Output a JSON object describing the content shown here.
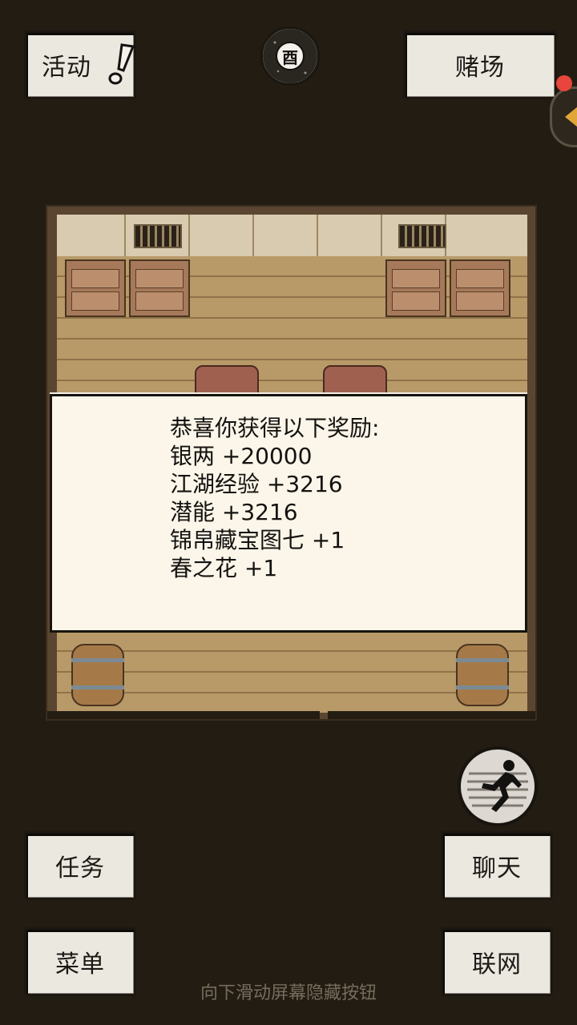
{
  "top_bar": {
    "activity_label": "活动",
    "casino_label": "赌场",
    "time_glyph": "酉"
  },
  "reward_dialog": {
    "title": "恭喜你获得以下奖励:",
    "rewards": [
      "银两 +20000",
      "江湖经验 +3216",
      "潜能 +3216",
      "锦帛藏宝图七 +1",
      "春之花 +1"
    ]
  },
  "bottom_bar": {
    "task_label": "任务",
    "menu_label": "菜单",
    "chat_label": "聊天",
    "network_label": "联网",
    "hint": "向下滑动屏幕隐藏按钮"
  },
  "icons": {
    "activity_alert": "exclamation-icon",
    "time": "time-of-day-icon",
    "side_panel": "chevron-left-icon",
    "run": "running-man-icon"
  },
  "colors": {
    "background": "#231c12",
    "button_paper": "#ebe8e0",
    "dialog_paper": "#fbf6e9",
    "notification": "#e8453c"
  }
}
